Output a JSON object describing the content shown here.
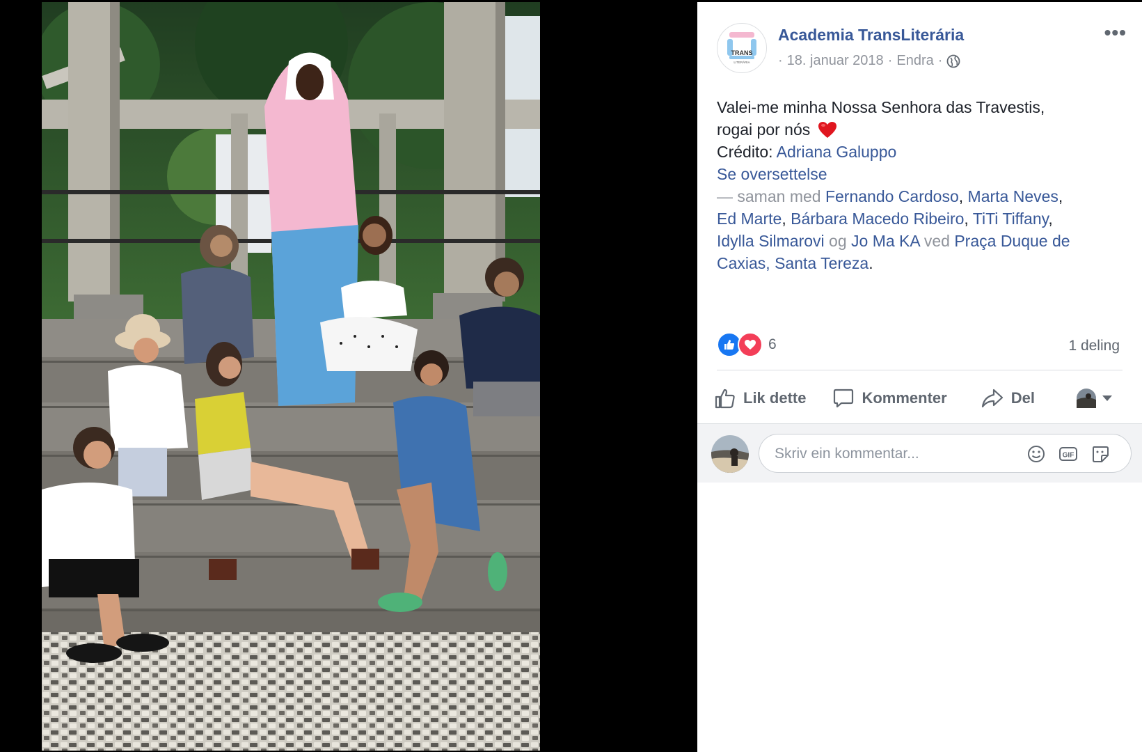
{
  "post": {
    "page_name": "Academia TransLiterária",
    "logo_text": "TRANS",
    "logo_subtext": "LITERÁRIA",
    "meta": {
      "separator": "·",
      "date": "18. januar 2018",
      "edited": "Endra",
      "audience_icon": "globe-icon"
    },
    "more_label": "•••",
    "text": {
      "line1": "Valei-me minha Nossa Senhora das Travestis,",
      "line2": "rogai por nós",
      "heart_emoji": "heart-emoji",
      "credit_prefix": "Crédito:",
      "credit_name": "Adriana Galuppo",
      "translate": "Se oversettelse"
    },
    "tags": {
      "prefix": "— saman med",
      "people": [
        "Fernando Cardoso",
        "Marta Neves",
        "Ed Marte",
        "Bárbara Macedo Ribeiro",
        "TiTi Tiffany",
        "Idylla Silmarovi",
        "Jo Ma KA"
      ],
      "comma": ",",
      "and_word": "og",
      "at_word": "ved",
      "location_part1": "Praça Duque de",
      "location_part2": "Caxias, Santa Tereza",
      "period": "."
    },
    "reactions": {
      "types": [
        "like",
        "love"
      ],
      "count": "6",
      "shares": "1 deling",
      "colors": {
        "like": "#1877f2",
        "love": "#f33e58"
      }
    },
    "actions": {
      "like": "Lik dette",
      "comment": "Kommenter",
      "share": "Del"
    },
    "comment": {
      "placeholder": "Skriv ein kommentar...",
      "emoji_icon": "smiley-icon",
      "gif_label": "GIF",
      "sticker_icon": "sticker-icon"
    }
  },
  "colors": {
    "link": "#385898",
    "text": "#1d2129",
    "secondary": "#90949c",
    "flag_pink": "#f4b8d0",
    "flag_blue": "#5ba3d9",
    "flag_white": "#ffffff"
  }
}
